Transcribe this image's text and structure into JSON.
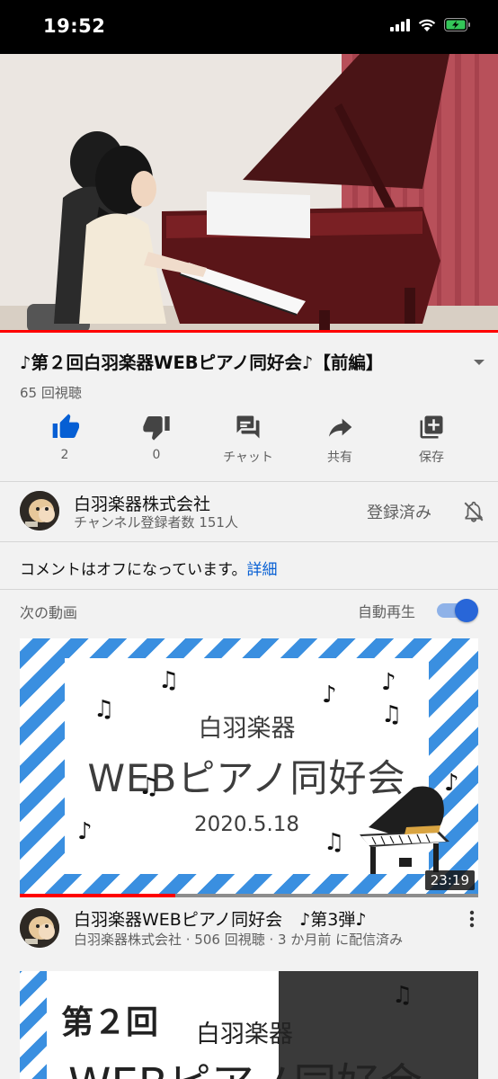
{
  "status_bar": {
    "time": "19:52",
    "battery_icon": "battery-charging-icon",
    "signal_icon": "cellular-signal-icon",
    "wifi_icon": "wifi-icon"
  },
  "video": {
    "title": "♪第２回白羽楽器WEBピアノ同好会♪【前編】",
    "views": "65 回視聴",
    "accent_color": "#ff0000"
  },
  "actions": [
    {
      "icon": "thumbs-up-icon",
      "label": "2"
    },
    {
      "icon": "thumbs-down-icon",
      "label": "0"
    },
    {
      "icon": "chat-icon",
      "label": "チャット"
    },
    {
      "icon": "share-icon",
      "label": "共有"
    },
    {
      "icon": "save-playlist-icon",
      "label": "保存"
    }
  ],
  "channel": {
    "name": "白羽楽器株式会社",
    "subscribers": "チャンネル登録者数 151人",
    "subscribed_label": "登録済み"
  },
  "comments": {
    "text": "コメントはオフになっています。",
    "link": "詳細"
  },
  "up_next": {
    "title": "次の動画",
    "autoplay_label": "自動再生",
    "autoplay_on": true
  },
  "recommendations": [
    {
      "thumb_brand": "白羽楽器",
      "thumb_title": "WEBピアノ同好会",
      "thumb_date": "2020.5.18",
      "duration": "23:19",
      "watched_fraction": 0.34,
      "title": "白羽楽器WEBピアノ同好会　♪第3弾♪",
      "subtitle": "白羽楽器株式会社 · 506 回視聴 · 3 か月前 に配信済み"
    },
    {
      "thumb_round": "第２回",
      "thumb_brand": "白羽楽器",
      "thumb_title": "WEBピアノ同好会"
    }
  ]
}
